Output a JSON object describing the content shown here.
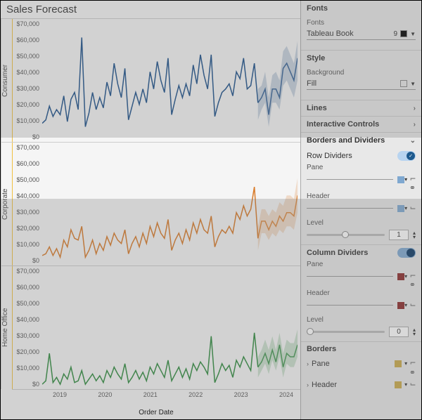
{
  "title": "Sales Forecast",
  "xlabel": "Order Date",
  "xticks": [
    "2019",
    "2020",
    "2021",
    "2022",
    "2023",
    "2024"
  ],
  "segments": [
    {
      "name": "Consumer",
      "color": "#1b4f8a"
    },
    {
      "name": "Corporate",
      "color": "#d97b29"
    },
    {
      "name": "Home Office",
      "color": "#2e8b3d"
    }
  ],
  "yticks": [
    "$70,000",
    "$60,000",
    "$50,000",
    "$40,000",
    "$30,000",
    "$20,000",
    "$10,000",
    "$0"
  ],
  "side": {
    "fonts": {
      "hdr": "Fonts",
      "label": "Fonts",
      "value": "Tableau Book",
      "size": "9"
    },
    "style": {
      "hdr": "Style",
      "bg": "Background",
      "fill": "Fill"
    },
    "lines": "Lines",
    "interactive": "Interactive Controls",
    "bd": {
      "hdr": "Borders and Dividers",
      "rowdiv": "Row Dividers",
      "pane": "Pane",
      "header": "Header",
      "level": "Level",
      "coldiv": "Column Dividers",
      "borders": "Borders"
    },
    "rowLevelVal": "1",
    "colLevelVal": "0"
  },
  "chart_data": [
    {
      "type": "line",
      "series_name": "Consumer",
      "ylim": [
        0,
        70000
      ],
      "x_start": 2018.5,
      "x_end": 2024.0,
      "y": [
        10000,
        12000,
        20000,
        14000,
        18000,
        15000,
        26000,
        11000,
        24000,
        28000,
        18000,
        60000,
        8000,
        16000,
        28000,
        18000,
        25000,
        19000,
        34000,
        26000,
        45000,
        33000,
        25000,
        42000,
        12000,
        20000,
        28000,
        21000,
        30000,
        22000,
        40000,
        30000,
        46000,
        35000,
        28000,
        48000,
        15000,
        24000,
        32000,
        25000,
        33000,
        26000,
        44000,
        33000,
        50000,
        38000,
        30000,
        50000,
        14000,
        22000,
        28000,
        30000,
        33000,
        26000,
        40000,
        36000,
        48000,
        30000,
        32000,
        45000,
        22000,
        25000,
        30000,
        15000,
        30000,
        30000,
        25000,
        42000,
        45000,
        40000,
        35000,
        48000
      ],
      "forecast_from_index": 60,
      "forecast_band": [
        [
          12000,
          30000
        ],
        [
          18000,
          32000
        ],
        [
          22000,
          40000
        ],
        [
          8000,
          25000
        ],
        [
          22000,
          38000
        ],
        [
          22000,
          40000
        ],
        [
          18000,
          35000
        ],
        [
          32000,
          52000
        ],
        [
          35000,
          55000
        ],
        [
          30000,
          50000
        ],
        [
          25000,
          45000
        ],
        [
          35000,
          58000
        ]
      ]
    },
    {
      "type": "line",
      "series_name": "Corporate",
      "ylim": [
        0,
        70000
      ],
      "x_start": 2018.5,
      "x_end": 2024.0,
      "y": [
        5000,
        6000,
        10000,
        5000,
        9000,
        4000,
        14000,
        10000,
        20000,
        15000,
        14000,
        22000,
        4000,
        8000,
        14000,
        6000,
        12000,
        8000,
        16000,
        11000,
        18000,
        14000,
        12000,
        20000,
        6000,
        12000,
        16000,
        10000,
        18000,
        12000,
        22000,
        16000,
        24000,
        18000,
        15000,
        26000,
        8000,
        14000,
        18000,
        12000,
        20000,
        14000,
        24000,
        18000,
        26000,
        20000,
        18000,
        28000,
        10000,
        16000,
        20000,
        18000,
        22000,
        18000,
        30000,
        26000,
        34000,
        28000,
        32000,
        45000,
        15000,
        25000,
        25000,
        20000,
        25000,
        22000,
        28000,
        25000,
        30000,
        30000,
        28000,
        40000
      ],
      "forecast_from_index": 60,
      "forecast_band": [
        [
          8000,
          22000
        ],
        [
          18000,
          32000
        ],
        [
          18000,
          32000
        ],
        [
          14000,
          28000
        ],
        [
          18000,
          32000
        ],
        [
          16000,
          30000
        ],
        [
          20000,
          36000
        ],
        [
          18000,
          34000
        ],
        [
          22000,
          40000
        ],
        [
          22000,
          40000
        ],
        [
          20000,
          38000
        ],
        [
          30000,
          50000
        ]
      ]
    },
    {
      "type": "line",
      "series_name": "Home Office",
      "ylim": [
        0,
        70000
      ],
      "x_start": 2018.5,
      "x_end": 2024.0,
      "y": [
        2000,
        4000,
        20000,
        3000,
        6000,
        2000,
        8000,
        5000,
        12000,
        3000,
        4000,
        10000,
        2000,
        5000,
        8000,
        4000,
        7000,
        3000,
        10000,
        6000,
        12000,
        8000,
        5000,
        14000,
        3000,
        6000,
        10000,
        5000,
        9000,
        4000,
        12000,
        8000,
        14000,
        10000,
        6000,
        16000,
        4000,
        8000,
        12000,
        6000,
        11000,
        5000,
        14000,
        10000,
        15000,
        12000,
        8000,
        30000,
        3000,
        8000,
        14000,
        10000,
        13000,
        6000,
        16000,
        12000,
        18000,
        14000,
        10000,
        32000,
        12000,
        15000,
        20000,
        14000,
        22000,
        15000,
        25000,
        12000,
        20000,
        18000,
        18000,
        25000
      ],
      "forecast_from_index": 60,
      "forecast_band": [
        [
          6000,
          18000
        ],
        [
          10000,
          22000
        ],
        [
          14000,
          28000
        ],
        [
          8000,
          22000
        ],
        [
          16000,
          30000
        ],
        [
          10000,
          22000
        ],
        [
          18000,
          32000
        ],
        [
          6000,
          20000
        ],
        [
          14000,
          28000
        ],
        [
          12000,
          26000
        ],
        [
          12000,
          26000
        ],
        [
          18000,
          34000
        ]
      ]
    }
  ]
}
